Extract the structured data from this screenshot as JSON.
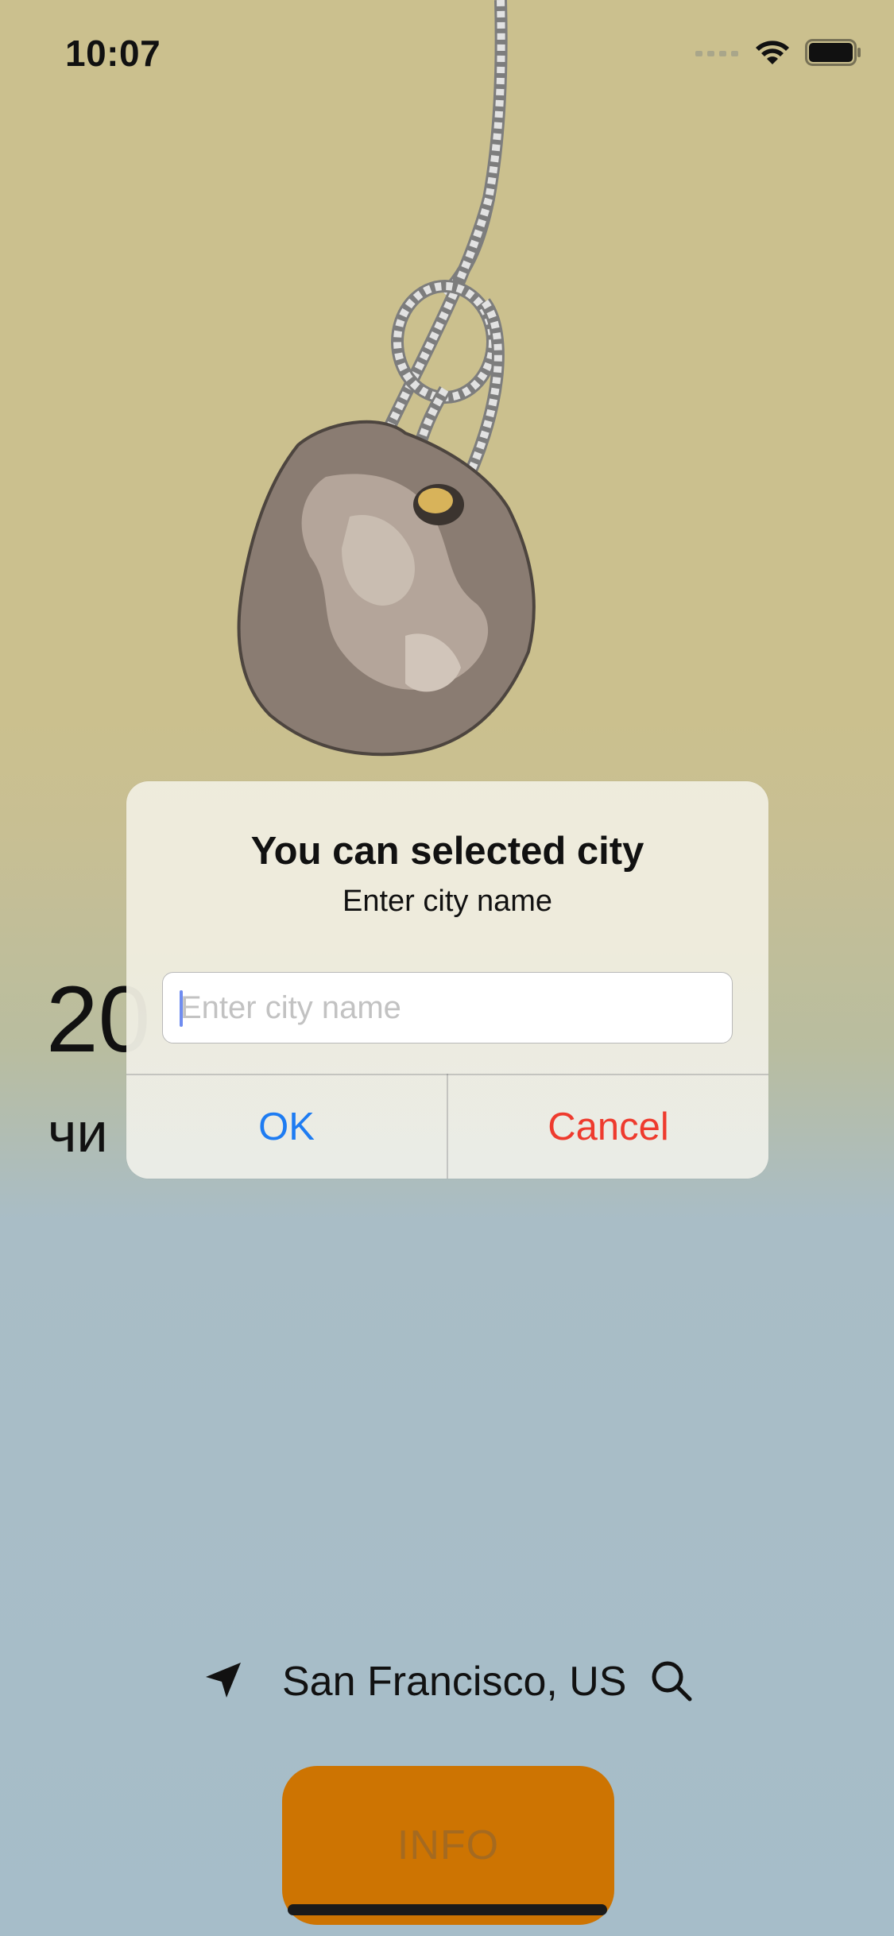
{
  "status_bar": {
    "time": "10:07"
  },
  "weather": {
    "temperature_partial": "20",
    "description_partial": "чи"
  },
  "alert": {
    "title": "You can selected city",
    "message": "Enter city name",
    "input_value": "",
    "input_placeholder": "Enter city name",
    "ok_label": "OK",
    "cancel_label": "Cancel"
  },
  "location": {
    "city": "San Francisco, US",
    "location_icon": "location-arrow-icon",
    "search_icon": "search-icon"
  },
  "info_button": {
    "label": "INFO"
  },
  "colors": {
    "background_top": "#cbc08e",
    "background_bottom": "#a6bdc9",
    "accent_blue": "#1e7cf2",
    "destructive_red": "#ee3b2e",
    "info_button": "#cd7402"
  }
}
